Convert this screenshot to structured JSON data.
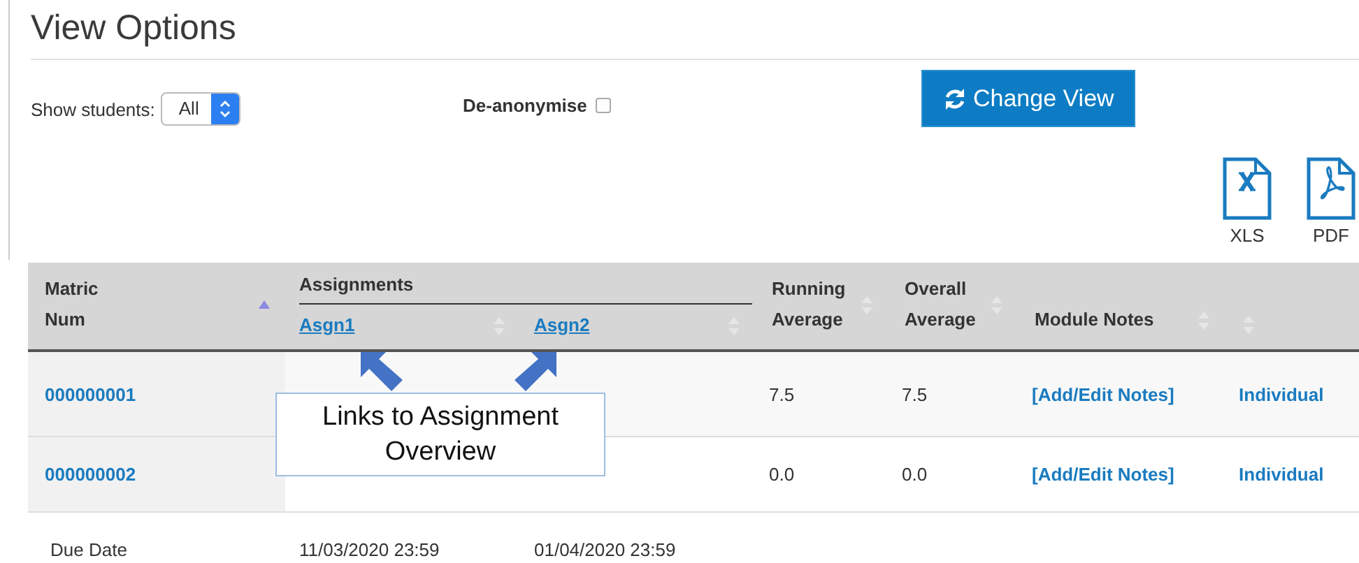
{
  "page": {
    "title": "View Options"
  },
  "filters": {
    "show_students_label": "Show students:",
    "show_students_value": "All",
    "deanonymise_label": "De-anonymise",
    "deanonymise_checked": false
  },
  "change_view_button": {
    "label": "Change View"
  },
  "exports": [
    {
      "kind": "xls",
      "label": "XLS"
    },
    {
      "kind": "pdf",
      "label": "PDF"
    }
  ],
  "table": {
    "group_header": "Assignments",
    "columns": [
      {
        "kind": "plain",
        "label": "Matric Num",
        "sorted": true
      },
      {
        "kind": "assignment",
        "label": "Asgn1",
        "sorted": false
      },
      {
        "kind": "assignment",
        "label": "Asgn2",
        "sorted": false
      },
      {
        "kind": "plain",
        "label": "Running Average",
        "sorted": false
      },
      {
        "kind": "plain",
        "label": "Overall Average",
        "sorted": false
      },
      {
        "kind": "plain",
        "label": "Module Notes",
        "sorted": false
      },
      {
        "kind": "plain",
        "sorted": false
      }
    ],
    "rows": [
      {
        "matric": "000000001",
        "running": "7.5",
        "overall": "7.5",
        "notes": "[Add/Edit Notes]",
        "view": "Individual"
      },
      {
        "matric": "000000002",
        "running": "0.0",
        "overall": "0.0",
        "notes": "[Add/Edit Notes]",
        "view": "Individual"
      }
    ],
    "footer": {
      "label": "Due Date",
      "dates": [
        "11/03/2020 23:59",
        "01/04/2020 23:59"
      ]
    }
  },
  "callout": {
    "text": "Links to Assignment Overview"
  }
}
